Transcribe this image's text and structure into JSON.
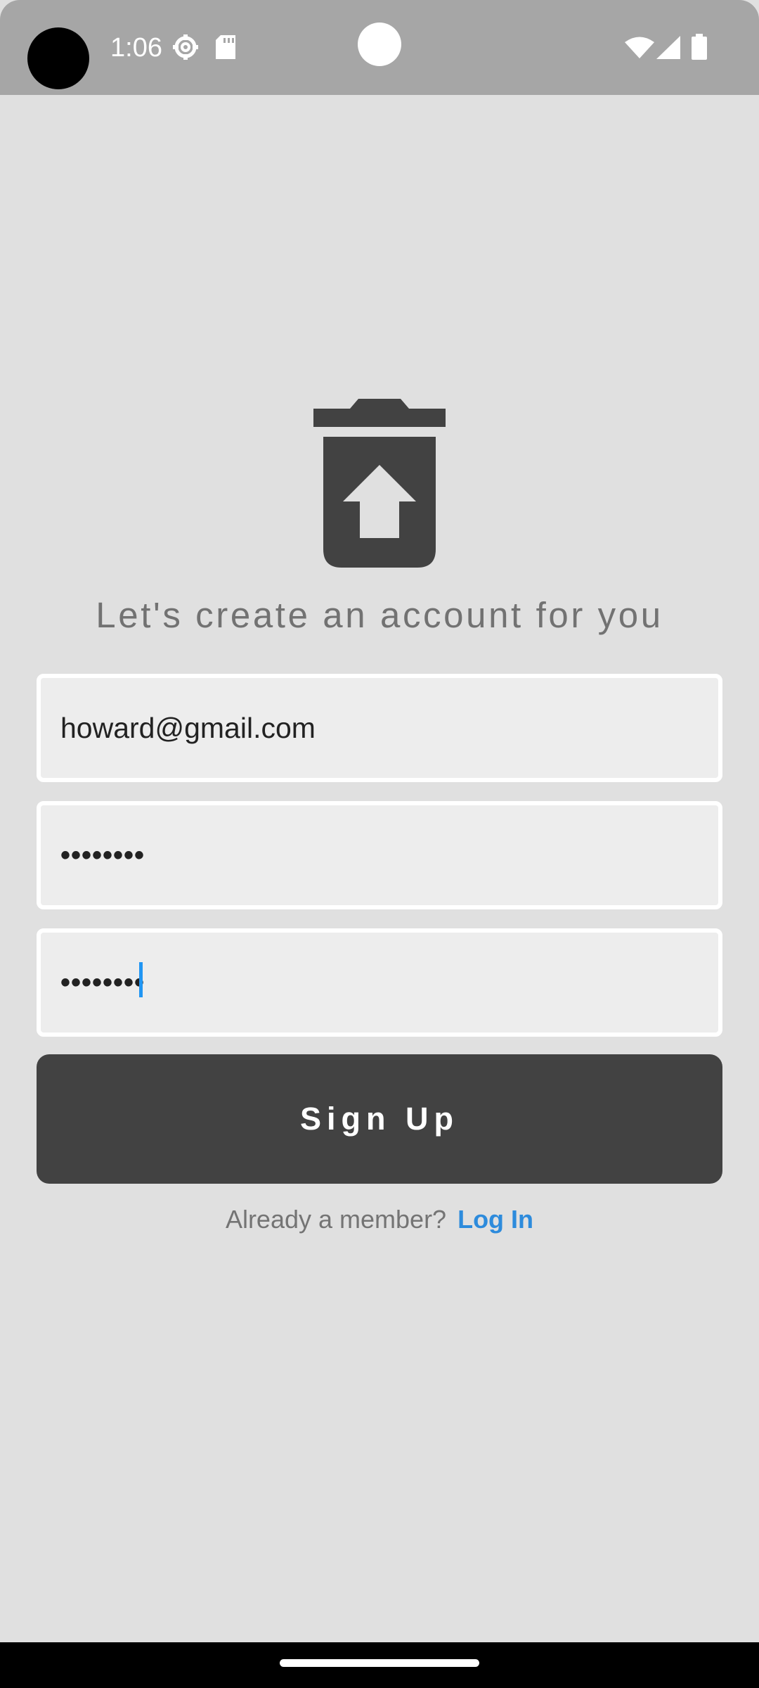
{
  "status_bar": {
    "time": "1:06",
    "icons": [
      "settings-icon",
      "sd-card-icon",
      "wifi-icon",
      "cellular-signal-icon",
      "battery-icon"
    ]
  },
  "logo": {
    "icon": "trash-restore-icon",
    "color": "#424242"
  },
  "form": {
    "headline": "Let's create an account for you",
    "email_value": "howard@gmail.com",
    "password_value": "••••••••",
    "confirm_password_value": "••••••••",
    "signup_label": "Sign Up"
  },
  "footer": {
    "member_text": "Already a member?",
    "login_label": "Log In"
  },
  "colors": {
    "background": "#e0e0e0",
    "status_bar": "#a6a6a6",
    "button": "#424242",
    "link": "#2d8bdc",
    "caret": "#2196f3"
  }
}
